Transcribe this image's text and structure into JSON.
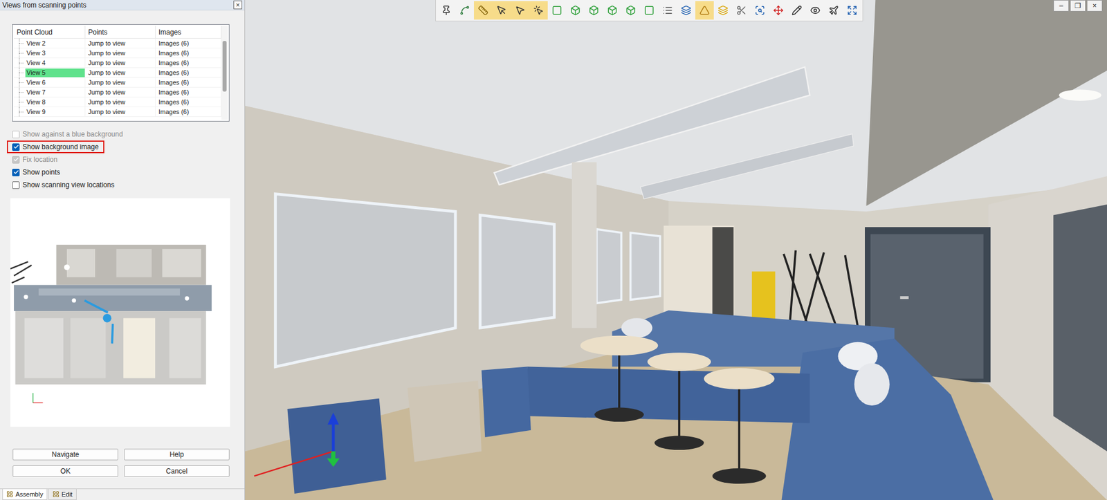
{
  "window": {
    "title": "Views from scanning points",
    "close": "×"
  },
  "table": {
    "columns": [
      "Point Cloud",
      "Points",
      "Images"
    ],
    "rows": [
      {
        "name": "View 2",
        "points": "Jump to view",
        "images": "Images (6)",
        "selected": false
      },
      {
        "name": "View 3",
        "points": "Jump to view",
        "images": "Images (6)",
        "selected": false
      },
      {
        "name": "View 4",
        "points": "Jump to view",
        "images": "Images (6)",
        "selected": false
      },
      {
        "name": "View 5",
        "points": "Jump to view",
        "images": "Images (6)",
        "selected": true
      },
      {
        "name": "View 6",
        "points": "Jump to view",
        "images": "Images (6)",
        "selected": false
      },
      {
        "name": "View 7",
        "points": "Jump to view",
        "images": "Images (6)",
        "selected": false
      },
      {
        "name": "View 8",
        "points": "Jump to view",
        "images": "Images (6)",
        "selected": false
      },
      {
        "name": "View 9",
        "points": "Jump to view",
        "images": "Images (6)",
        "selected": false
      }
    ]
  },
  "options": [
    {
      "label": "Show against a blue background",
      "checked": false,
      "disabled": true,
      "highlighted": false
    },
    {
      "label": "Show background image",
      "checked": true,
      "disabled": false,
      "highlighted": true
    },
    {
      "label": "Fix location",
      "checked": true,
      "disabled": true,
      "highlighted": false
    },
    {
      "label": "Show points",
      "checked": true,
      "disabled": false,
      "highlighted": false
    },
    {
      "label": "Show scanning view locations",
      "checked": false,
      "disabled": false,
      "highlighted": false
    }
  ],
  "buttons": [
    "Navigate",
    "Help",
    "OK",
    "Cancel"
  ],
  "bottom_tabs": [
    {
      "label": "Assembly",
      "selected": true
    },
    {
      "label": "Edit",
      "selected": false
    }
  ],
  "toolbar": [
    {
      "selected": false
    },
    {
      "selected": false
    },
    {
      "selected": true
    },
    {
      "selected": true
    },
    {
      "selected": true
    },
    {
      "selected": true
    },
    {
      "selected": false
    },
    {
      "selected": false
    },
    {
      "selected": false
    },
    {
      "selected": false
    },
    {
      "selected": false
    },
    {
      "selected": false
    },
    {
      "selected": false
    },
    {
      "selected": false
    },
    {
      "selected": true
    },
    {
      "selected": false
    },
    {
      "selected": false
    },
    {
      "selected": false
    },
    {
      "selected": false
    },
    {
      "selected": false
    },
    {
      "selected": false
    },
    {
      "selected": false
    },
    {
      "selected": false
    }
  ],
  "app_controls": [
    "–",
    "❐",
    "×"
  ]
}
